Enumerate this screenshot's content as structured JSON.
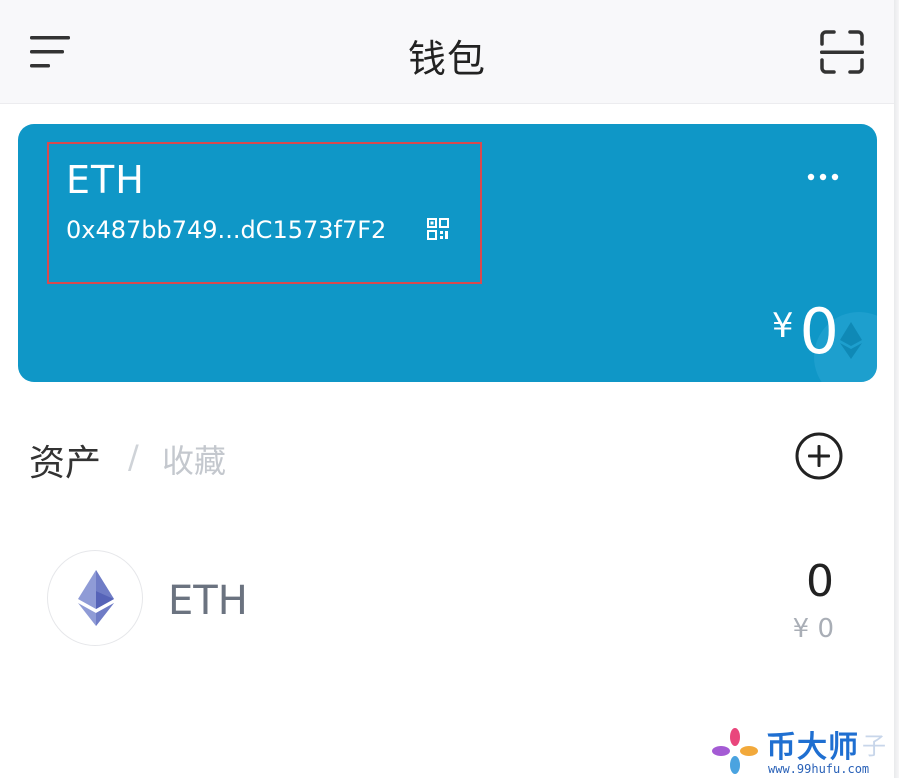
{
  "header": {
    "title": "钱包",
    "menu_icon": "menu-icon",
    "scan_icon": "scan-icon"
  },
  "wallet_card": {
    "name": "ETH",
    "address": "0x487bb749...dC1573f7F2",
    "currency_symbol": "¥",
    "balance": "0",
    "background_color": "#0f97c7",
    "highlight_color": "#d84a4f"
  },
  "tabs": {
    "assets": "资产",
    "separator": "/",
    "favorites": "收藏"
  },
  "assets": [
    {
      "name": "ETH",
      "amount": "0",
      "fiat_value": "¥ 0",
      "icon": "ethereum-icon"
    }
  ],
  "watermark": {
    "text": "币大师",
    "extra": "子",
    "url": "www.99hufu.com"
  }
}
